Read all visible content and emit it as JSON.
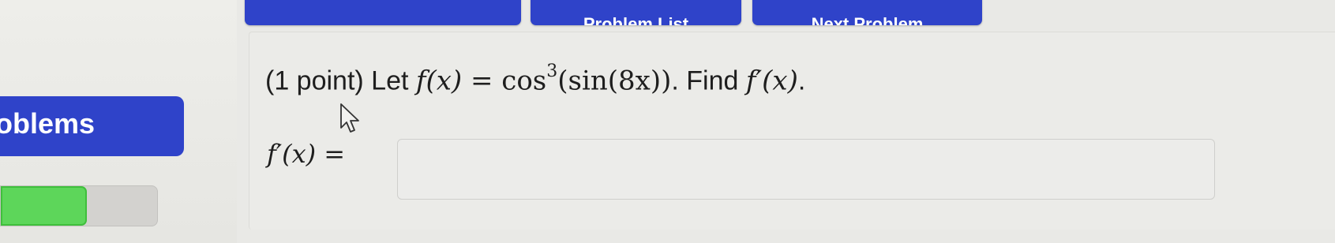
{
  "nav": {
    "buttons": [
      {
        "label": ""
      },
      {
        "label": "Problem List"
      },
      {
        "label": "Next Problem"
      }
    ],
    "sidebar_label": "oblems",
    "progress_fraction": 0.55,
    "progress_color": "#5dd65a"
  },
  "problem": {
    "points": "(1 point) Let ",
    "fx": "f(x)",
    "equals": " = ",
    "cos": "cos",
    "power": "3",
    "inner": "(sin(8x))",
    "find_text": ". Find ",
    "fprime": "f′(x)",
    "end": "."
  },
  "answer": {
    "label": "f′(x) =",
    "value": "",
    "placeholder": ""
  },
  "colors": {
    "accent": "#2f43c9",
    "background": "#e9e9e6"
  },
  "icons": {
    "cursor": "arrow-pointer-icon"
  }
}
